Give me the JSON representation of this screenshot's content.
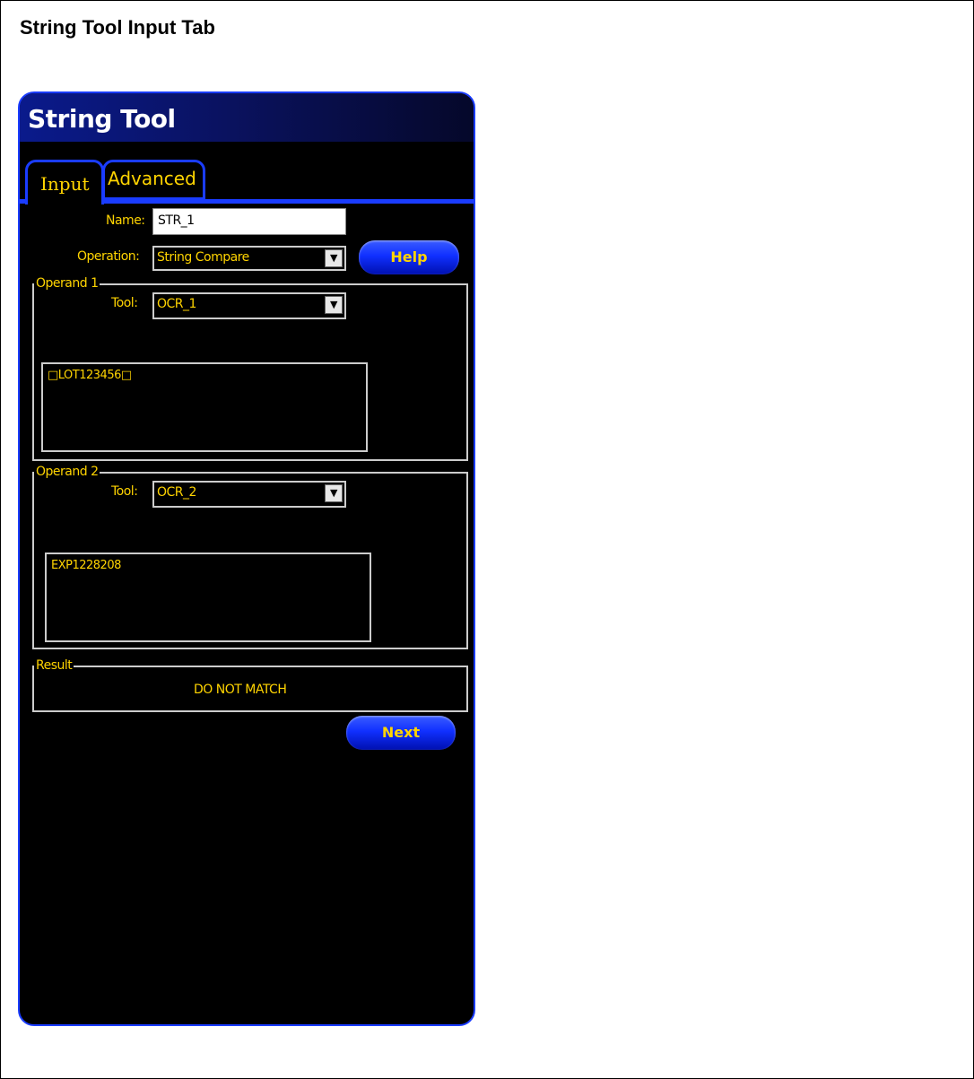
{
  "doc": {
    "title": "String Tool Input Tab"
  },
  "window": {
    "title": "String Tool"
  },
  "tabs": [
    {
      "label": "Input",
      "active": true
    },
    {
      "label": "Advanced",
      "active": false
    }
  ],
  "form": {
    "name_label": "Name:",
    "name_value": "STR_1",
    "operation_label": "Operation:",
    "operation_value": "String Compare",
    "help_button": "Help"
  },
  "operand1": {
    "title": "Operand 1",
    "tool_label": "Tool:",
    "tool_value": "OCR_1",
    "text": "□LOT123456□"
  },
  "operand2": {
    "title": "Operand 2",
    "tool_label": "Tool:",
    "tool_value": "OCR_2",
    "text": "EXP1228208"
  },
  "result": {
    "title": "Result",
    "value": "DO NOT MATCH"
  },
  "next_button": "Next",
  "colors": {
    "accent": "#1a3cff",
    "label": "#ffd400",
    "background": "#000000"
  }
}
